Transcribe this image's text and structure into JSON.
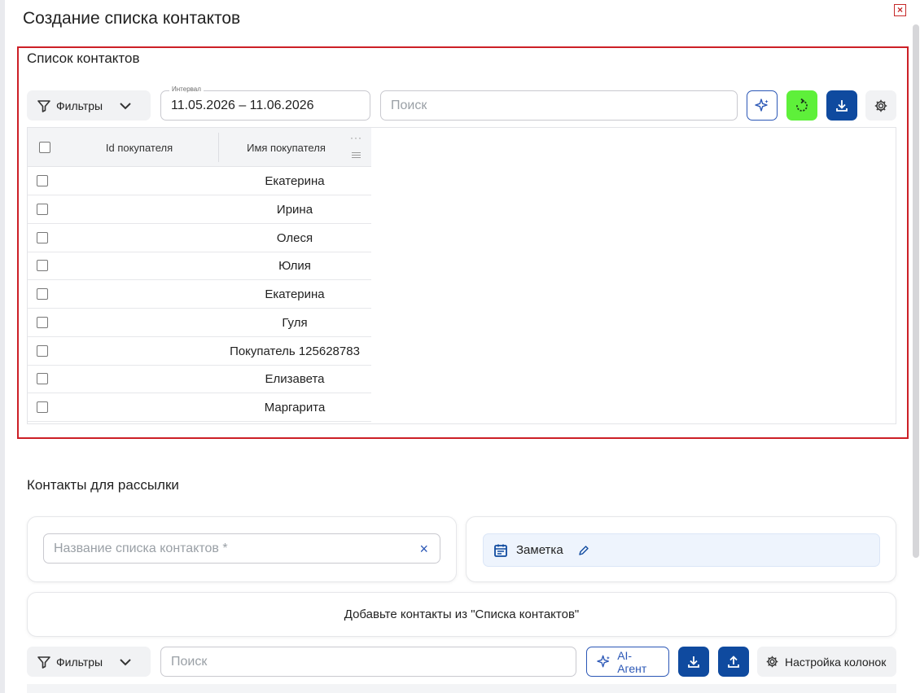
{
  "modal": {
    "title": "Создание списка контактов",
    "close_label": "×"
  },
  "contacts_list": {
    "title": "Список контактов",
    "filters_label": "Фильтры",
    "interval": {
      "legend": "Интервал",
      "value": "11.05.2026 – 11.06.2026"
    },
    "search_placeholder": "Поиск",
    "columns": [
      "Id покупателя",
      "Имя покупателя"
    ],
    "column_menu": "···",
    "rows": [
      {
        "id": "",
        "name": "Екатерина"
      },
      {
        "id": "",
        "name": "Ирина"
      },
      {
        "id": "",
        "name": "Олеся"
      },
      {
        "id": "",
        "name": "Юлия"
      },
      {
        "id": "",
        "name": "Екатерина"
      },
      {
        "id": "",
        "name": "Гуля"
      },
      {
        "id": "",
        "name": "Покупатель 125628783"
      },
      {
        "id": "",
        "name": "Елизавета"
      },
      {
        "id": "",
        "name": "Маргарита"
      }
    ],
    "icons": [
      "sparkle-icon",
      "refresh-icon",
      "download-icon",
      "gear-icon"
    ],
    "colors": {
      "accent": "#0f4a9f",
      "refresh": "#5ef03a",
      "highlight_border": "#cc1f26"
    }
  },
  "mailing": {
    "title": "Контакты для рассылки",
    "name_placeholder": "Название списка контактов *",
    "clear_label": "×",
    "note_label": "Заметка",
    "hint": "Добавьте контакты из \"Списка контактов\"",
    "filters_label": "Фильтры",
    "search_placeholder": "Поиск",
    "ai_label": "AI-Агент",
    "columns_settings_label": "Настройка колонок"
  }
}
